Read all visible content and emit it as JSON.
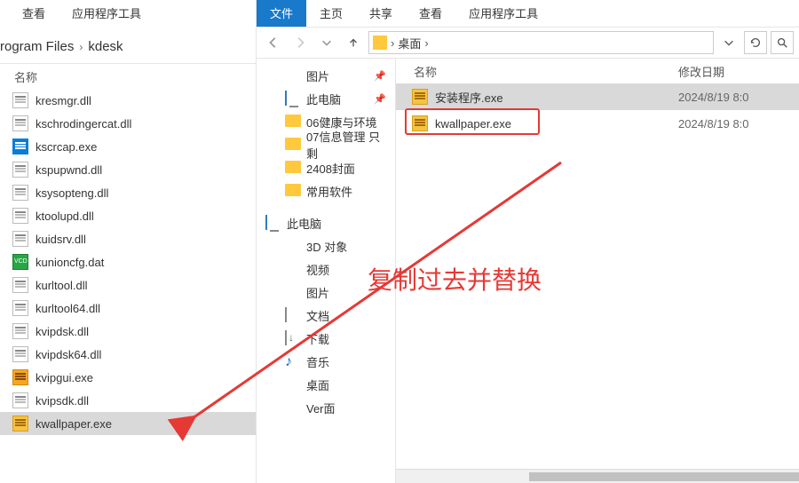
{
  "left": {
    "tabs": {
      "view": "查看",
      "tools": "应用程序工具"
    },
    "breadcrumb": {
      "seg1": "rogram Files",
      "seg2": "kdesk"
    },
    "col_name": "名称",
    "files": [
      {
        "name": "kresmgr.dll",
        "icon": "gear"
      },
      {
        "name": "kschrodingercat.dll",
        "icon": "gear"
      },
      {
        "name": "kscrcap.exe",
        "icon": "exe-blue"
      },
      {
        "name": "kspupwnd.dll",
        "icon": "gear"
      },
      {
        "name": "ksysopteng.dll",
        "icon": "gear"
      },
      {
        "name": "ktoolupd.dll",
        "icon": "gear"
      },
      {
        "name": "kuidsrv.dll",
        "icon": "gear"
      },
      {
        "name": "kunioncfg.dat",
        "icon": "vcd"
      },
      {
        "name": "kurltool.dll",
        "icon": "gear"
      },
      {
        "name": "kurltool64.dll",
        "icon": "gear"
      },
      {
        "name": "kvipdsk.dll",
        "icon": "gear"
      },
      {
        "name": "kvipdsk64.dll",
        "icon": "gear"
      },
      {
        "name": "kvipgui.exe",
        "icon": "exe-orange"
      },
      {
        "name": "kvipsdk.dll",
        "icon": "gear"
      },
      {
        "name": "kwallpaper.exe",
        "icon": "exe-yellow",
        "selected": true
      }
    ]
  },
  "right": {
    "tabs": {
      "file": "文件",
      "home": "主页",
      "share": "共享",
      "view": "查看",
      "tools": "应用程序工具"
    },
    "breadcrumb": {
      "seg1": "桌面"
    },
    "columns": {
      "name": "名称",
      "date": "修改日期"
    },
    "tree": {
      "quick": [
        {
          "label": "图片",
          "icon": "pictures",
          "pinned": true
        },
        {
          "label": "此电脑",
          "icon": "pc",
          "pinned": true
        },
        {
          "label": "06健康与环境",
          "icon": "folder"
        },
        {
          "label": "07信息管理 只剩",
          "icon": "folder"
        },
        {
          "label": "2408封面",
          "icon": "folder"
        },
        {
          "label": "常用软件",
          "icon": "folder"
        }
      ],
      "thispc_label": "此电脑",
      "thispc": [
        {
          "label": "3D 对象",
          "icon": "threed"
        },
        {
          "label": "视频",
          "icon": "video"
        },
        {
          "label": "图片",
          "icon": "pictures"
        },
        {
          "label": "文档",
          "icon": "docs"
        },
        {
          "label": "下载",
          "icon": "dl"
        },
        {
          "label": "音乐",
          "icon": "music"
        },
        {
          "label": "桌面",
          "icon": "desk"
        },
        {
          "label": "Ver面",
          "icon": "win"
        }
      ]
    },
    "files": [
      {
        "name": "安装程序.exe",
        "date": "2024/8/19 8:0",
        "icon": "exe-yellow",
        "selected": true
      },
      {
        "name": "kwallpaper.exe",
        "date": "2024/8/19 8:0",
        "icon": "exe-yellow",
        "highlighted": true
      }
    ]
  },
  "annotation": {
    "text": "复制过去并替换"
  }
}
